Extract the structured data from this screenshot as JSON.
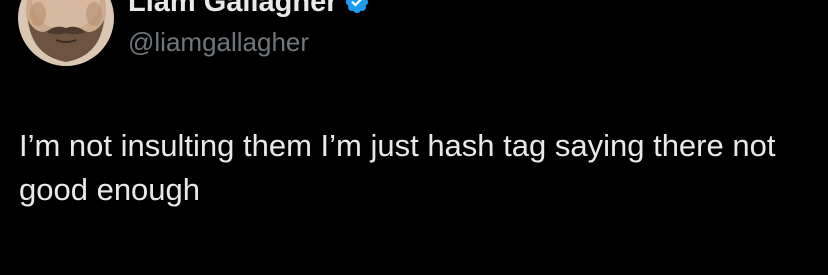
{
  "tweet": {
    "author": {
      "display_name": "Liam Gallagher",
      "handle": "@liamgallagher",
      "verified": true,
      "avatar_icon": "profile-photo"
    },
    "text": "I’m not insulting them I’m just hash tag saying there not good enough"
  },
  "colors": {
    "background": "#000000",
    "primary_text": "#e7e9ea",
    "secondary_text": "#71767b",
    "verified_badge": "#1d9bf0"
  }
}
